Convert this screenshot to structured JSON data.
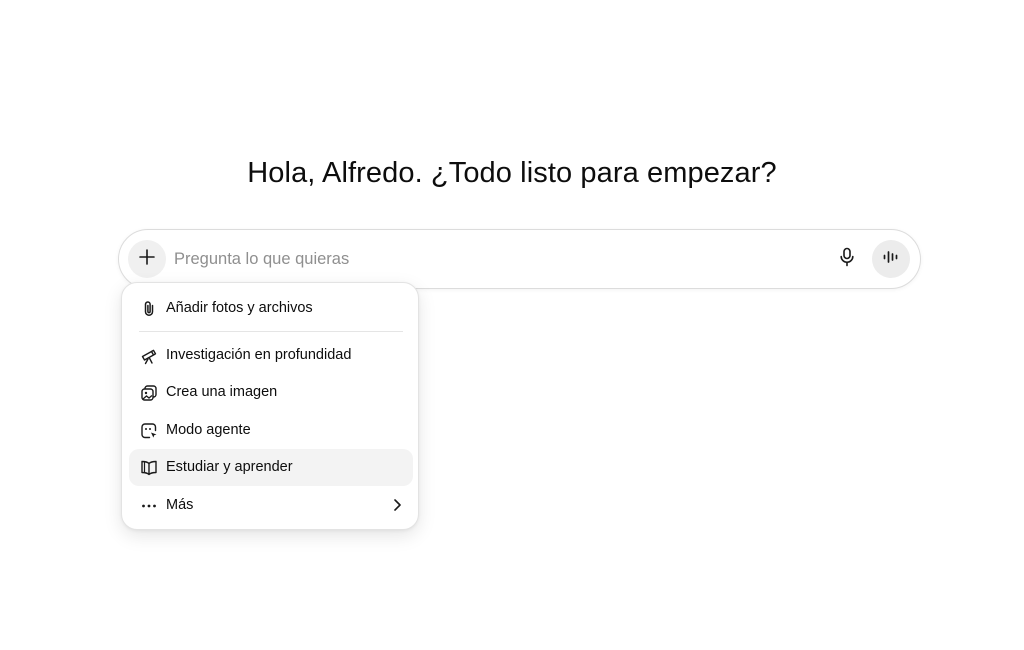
{
  "greeting": "Hola, Alfredo. ¿Todo listo para empezar?",
  "composer": {
    "placeholder": "Pregunta lo que quieras",
    "value": "",
    "icons": {
      "add": "plus-icon",
      "mic": "microphone-icon",
      "voice": "voice-waveform-icon"
    }
  },
  "menu": {
    "items": [
      {
        "label": "Añadir fotos y archivos",
        "icon": "paperclip-icon"
      },
      {
        "label": "Investigación en profundidad",
        "icon": "telescope-icon"
      },
      {
        "label": "Crea una imagen",
        "icon": "image-icon"
      },
      {
        "label": "Modo agente",
        "icon": "agent-cursor-icon"
      },
      {
        "label": "Estudiar y aprender",
        "icon": "open-book-icon",
        "highlighted": true
      },
      {
        "label": "Más",
        "icon": "more-dots-icon",
        "has_submenu": true
      }
    ]
  },
  "colors": {
    "text": "#0d0d0d",
    "placeholder": "#8f8f8f",
    "border": "#dcdcdc",
    "button_bg": "#f0f0f0",
    "highlight_bg": "#f3f3f3"
  }
}
